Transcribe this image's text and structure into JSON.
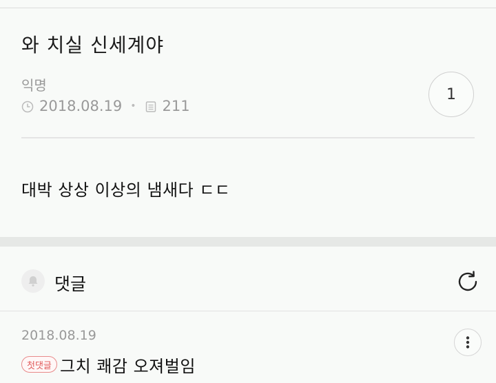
{
  "post": {
    "title": "와 치실 신세계야",
    "author": "익명",
    "date": "2018.08.19",
    "views": "211",
    "comment_count": "1",
    "body": "대박 상상 이상의 냄새다 ㄷㄷ"
  },
  "comments_section": {
    "label": "댓글",
    "icons": {
      "bell": "bell-icon",
      "refresh": "refresh-icon"
    }
  },
  "comments": [
    {
      "date": "2018.08.19",
      "badge": "첫댓글",
      "text": "그치 쾌감 오져벌임"
    }
  ],
  "colors": {
    "background": "#f8faf8",
    "badge_border": "#e88a8a",
    "badge_text": "#e05a5a",
    "muted_text": "#999999"
  }
}
